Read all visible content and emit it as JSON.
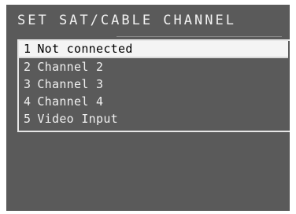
{
  "screen": {
    "title": "SET SAT/CABLE CHANNEL"
  },
  "menu": {
    "items": [
      {
        "number": "1",
        "label": "Not connected",
        "selected": true
      },
      {
        "number": "2",
        "label": "Channel 2",
        "selected": false
      },
      {
        "number": "3",
        "label": "Channel 3",
        "selected": false
      },
      {
        "number": "4",
        "label": "Channel 4",
        "selected": false
      },
      {
        "number": "5",
        "label": "Video Input",
        "selected": false
      }
    ]
  },
  "colors": {
    "background": "#5a5a5a",
    "text": "#f0f0f0",
    "highlight": "#f4f4f4",
    "highlight_text": "#000000"
  }
}
